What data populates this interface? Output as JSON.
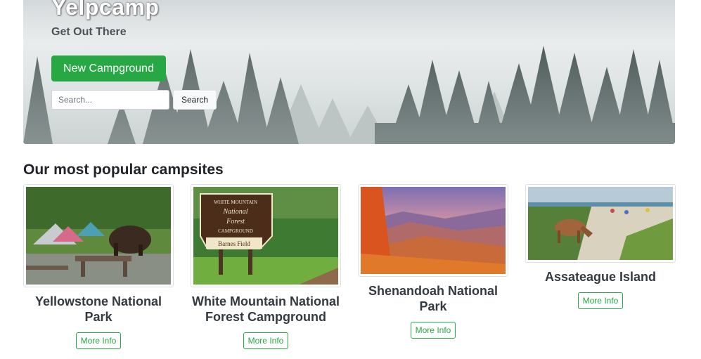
{
  "hero": {
    "title": "Yelpcamp",
    "subtitle": "Get Out There",
    "new_button_label": "New Campground",
    "search_placeholder": "Search...",
    "search_button_label": "Search"
  },
  "section": {
    "heading": "Our most popular campsites"
  },
  "campgrounds": [
    {
      "name": "Yellowstone National Park",
      "more_label": "More Info"
    },
    {
      "name": "White Mountain National Forest Campground",
      "more_label": "More Info"
    },
    {
      "name": "Shenandoah National Park",
      "more_label": "More Info"
    },
    {
      "name": "Assateague Island",
      "more_label": "More Info"
    }
  ],
  "sign": {
    "line1": "WHITE MOUNTAIN",
    "line2": "National",
    "line3": "Forest",
    "line4": "CAMPGROUND",
    "line5": "Barnes Field"
  },
  "colors": {
    "accent": "#28a745",
    "hero_text": "#ffffff"
  }
}
